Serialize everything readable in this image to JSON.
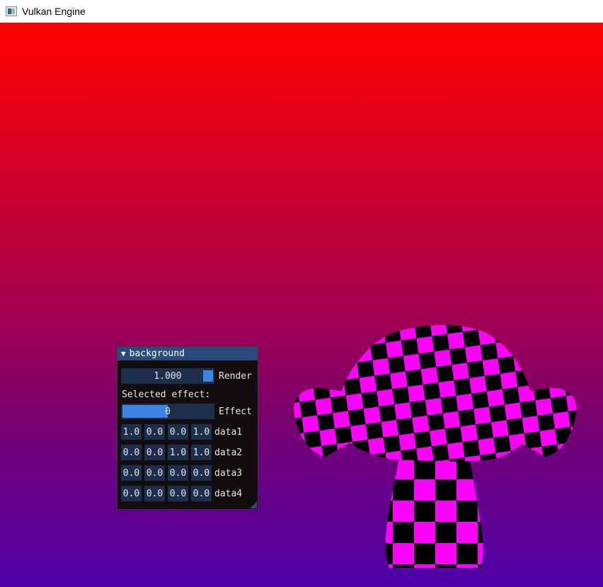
{
  "window": {
    "title": "Vulkan Engine",
    "icon": "app-window-icon"
  },
  "panel": {
    "title": "background",
    "collapse_icon": "triangle-down-icon",
    "render": {
      "value": "1.000",
      "label": "Render",
      "fraction": 1.0
    },
    "selected_label": "Selected effect:",
    "effect": {
      "value": "0",
      "label": "Effect",
      "fraction": 0.5
    },
    "rows": [
      {
        "label": "data1",
        "cells": [
          "1.0",
          "0.0",
          "0.0",
          "1.0"
        ]
      },
      {
        "label": "data2",
        "cells": [
          "0.0",
          "0.0",
          "1.0",
          "1.0"
        ]
      },
      {
        "label": "data3",
        "cells": [
          "0.0",
          "0.0",
          "0.0",
          "0.0"
        ]
      },
      {
        "label": "data4",
        "cells": [
          "0.0",
          "0.0",
          "0.0",
          "0.0"
        ]
      }
    ]
  },
  "colors": {
    "gradient_top": "#ff0000",
    "gradient_bottom": "#4e00a8",
    "checker_a": "#ff00ff",
    "checker_b": "#000000",
    "accent": "#3d85e0",
    "panel_bg": "#130d10",
    "title_bg": "#294a7a"
  }
}
